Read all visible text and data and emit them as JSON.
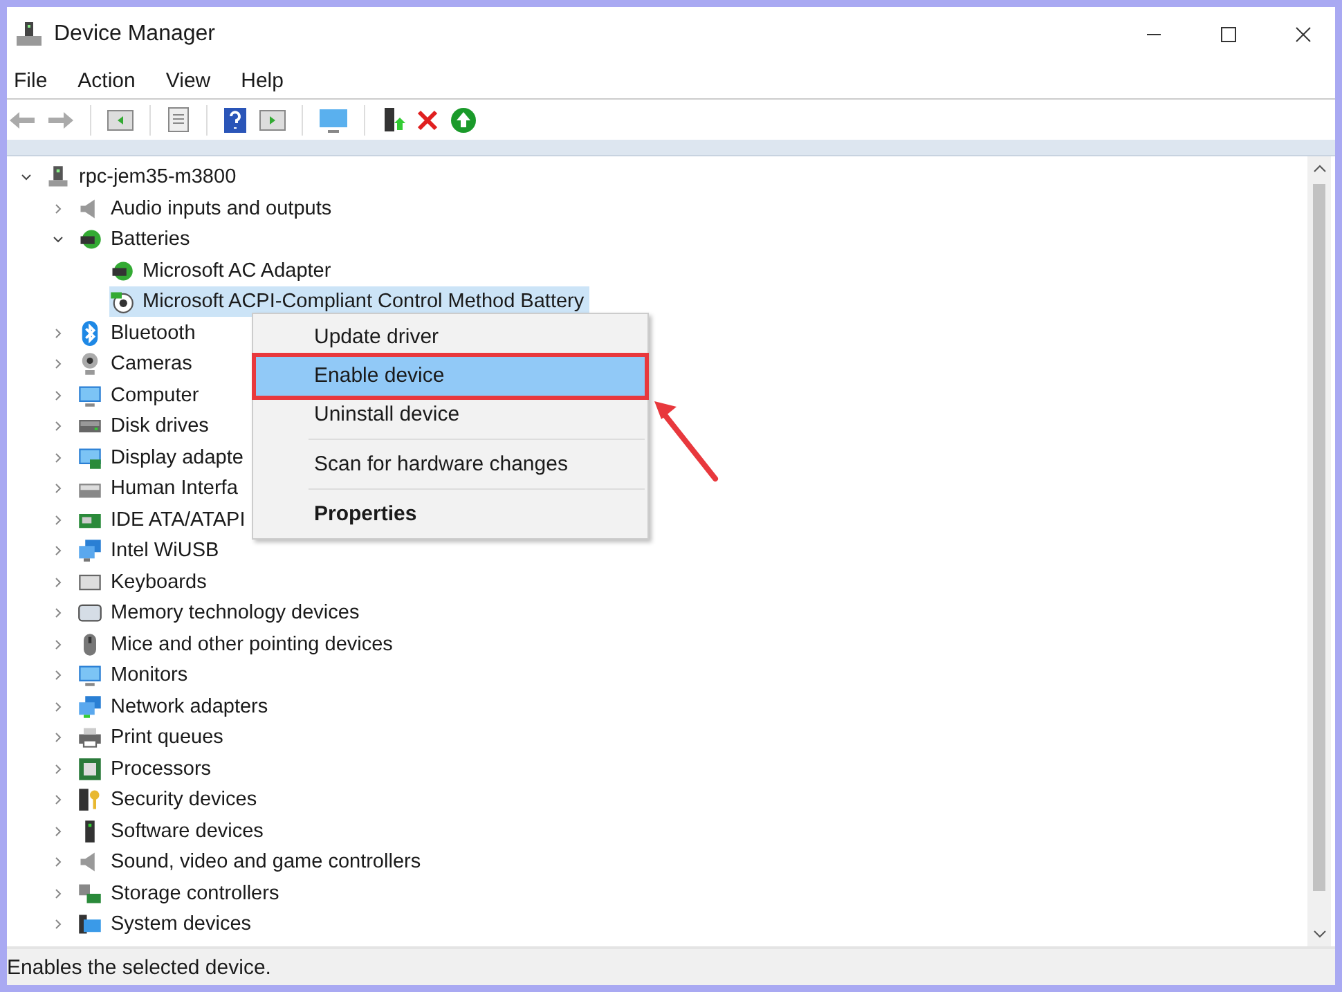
{
  "window": {
    "title": "Device Manager"
  },
  "menu_bar": [
    "File",
    "Action",
    "View",
    "Help"
  ],
  "tree": {
    "label": "rpc-jem35-m3800",
    "expanded": true,
    "selected": false,
    "children": [
      {
        "label": "Audio inputs and outputs",
        "expanded": false,
        "selected": false
      },
      {
        "label": "Batteries",
        "expanded": true,
        "selected": false,
        "children": [
          {
            "label": "Microsoft AC Adapter",
            "selected": false
          },
          {
            "label": "Microsoft ACPI-Compliant Control Method Battery",
            "selected": true
          }
        ]
      },
      {
        "label": "Bluetooth",
        "expanded": false,
        "selected": false
      },
      {
        "label": "Cameras",
        "expanded": false,
        "selected": false
      },
      {
        "label": "Computer",
        "expanded": false,
        "selected": false
      },
      {
        "label": "Disk drives",
        "expanded": false,
        "selected": false
      },
      {
        "label": "Display adapte",
        "expanded": false,
        "selected": false
      },
      {
        "label": "Human Interfa",
        "expanded": false,
        "selected": false
      },
      {
        "label": "IDE ATA/ATAPI",
        "expanded": false,
        "selected": false
      },
      {
        "label": "Intel WiUSB",
        "expanded": false,
        "selected": false
      },
      {
        "label": "Keyboards",
        "expanded": false,
        "selected": false
      },
      {
        "label": "Memory technology devices",
        "expanded": false,
        "selected": false
      },
      {
        "label": "Mice and other pointing devices",
        "expanded": false,
        "selected": false
      },
      {
        "label": "Monitors",
        "expanded": false,
        "selected": false
      },
      {
        "label": "Network adapters",
        "expanded": false,
        "selected": false
      },
      {
        "label": "Print queues",
        "expanded": false,
        "selected": false
      },
      {
        "label": "Processors",
        "expanded": false,
        "selected": false
      },
      {
        "label": "Security devices",
        "expanded": false,
        "selected": false
      },
      {
        "label": "Software devices",
        "expanded": false,
        "selected": false
      },
      {
        "label": "Sound, video and game controllers",
        "expanded": false,
        "selected": false
      },
      {
        "label": "Storage controllers",
        "expanded": false,
        "selected": false
      },
      {
        "label": "System devices",
        "expanded": false,
        "selected": false
      }
    ]
  },
  "context_menu": [
    {
      "kind": "item",
      "label": "Update driver",
      "selected": false,
      "annotated": false
    },
    {
      "kind": "item",
      "label": "Enable device",
      "selected": true,
      "annotated": true
    },
    {
      "kind": "item",
      "label": "Uninstall device",
      "selected": false,
      "annotated": false
    },
    {
      "kind": "separator"
    },
    {
      "kind": "item",
      "label": "Scan for hardware changes",
      "selected": false,
      "annotated": false
    },
    {
      "kind": "separator"
    },
    {
      "kind": "default",
      "label": "Properties",
      "selected": false,
      "annotated": false
    }
  ],
  "status_bar": "Enables the selected device."
}
